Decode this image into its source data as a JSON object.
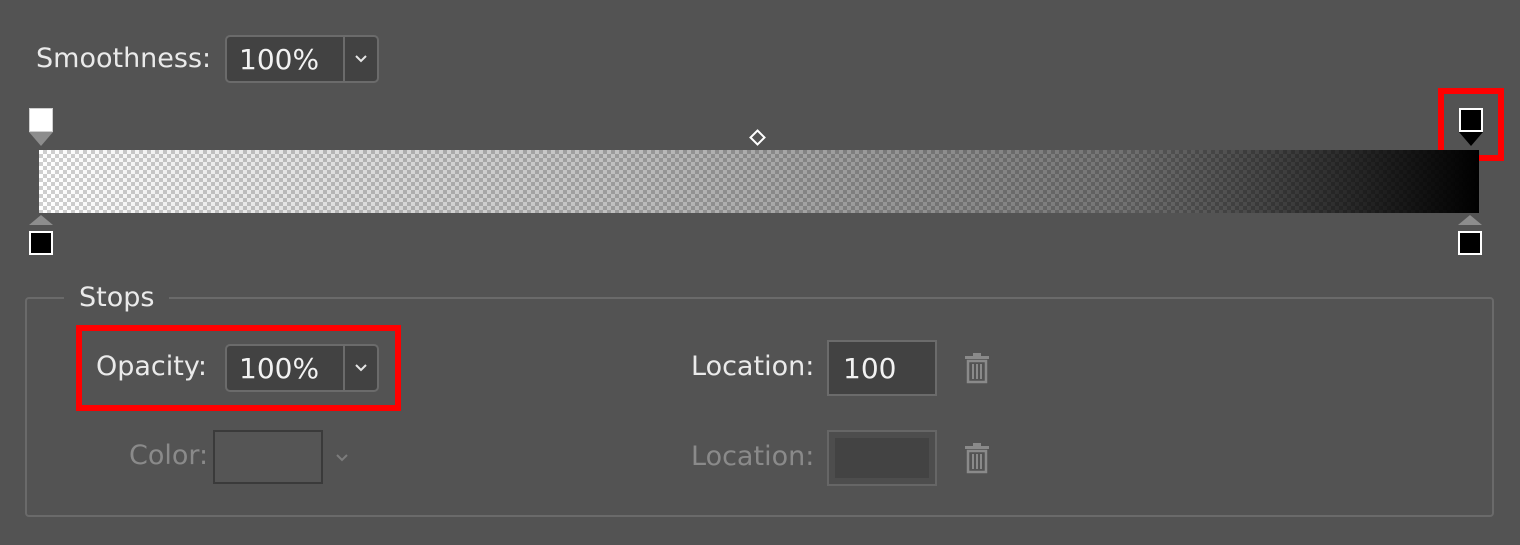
{
  "smoothness": {
    "label": "Smoothness:",
    "value": "100%"
  },
  "gradient": {
    "opacity_stops": [
      {
        "location": 0,
        "color": "#ffffff"
      },
      {
        "location": 100,
        "color": "#000000",
        "selected": true
      }
    ],
    "color_stops": [
      {
        "location": 0,
        "color": "#000000"
      },
      {
        "location": 100,
        "color": "#000000"
      }
    ],
    "midpoint": 50
  },
  "stops": {
    "title": "Stops",
    "opacity_label": "Opacity:",
    "opacity_value": "100%",
    "opacity_location_label": "Location:",
    "opacity_location_value": "100",
    "color_label": "Color:",
    "color_location_label": "Location:",
    "color_location_value": ""
  },
  "colors": {
    "background": "#535353",
    "highlight": "#ff0000"
  },
  "icons": [
    "chevron-down-icon",
    "trash-icon",
    "diamond-midpoint-icon"
  ]
}
